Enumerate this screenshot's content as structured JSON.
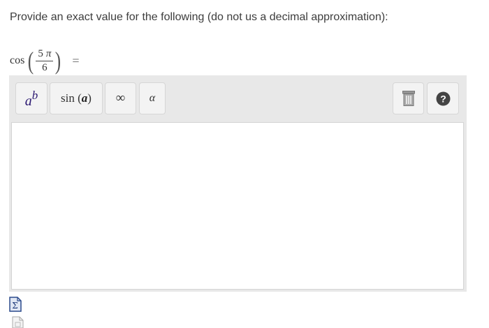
{
  "prompt": {
    "text": "Provide an exact value for the following (do not us a decimal approximation):"
  },
  "equation": {
    "function": "cos",
    "numerator": "5",
    "numerator_symbol": "π",
    "denominator": "6",
    "equals": "="
  },
  "toolbar": {
    "power_button": {
      "base": "a",
      "exponent": "b"
    },
    "function_button": {
      "name": "sin",
      "open": "(",
      "arg": "a",
      "close": ")"
    },
    "infinity_button": {
      "label": "∞"
    },
    "greek_button": {
      "label": "α"
    },
    "trash_button": {
      "icon": "trash-icon"
    },
    "help_button": {
      "icon": "question-icon",
      "label": "?"
    }
  },
  "input": {
    "value": ""
  },
  "attachments": [
    {
      "icon": "formula-document-icon"
    },
    {
      "icon": "blank-document-icon"
    }
  ],
  "colors": {
    "toolbar_bg": "#e8e8e8",
    "button_bg": "#f3f3f3",
    "power_text": "#2d1a73",
    "help_circle": "#444444",
    "formula_icon": "#2b4a8c"
  }
}
